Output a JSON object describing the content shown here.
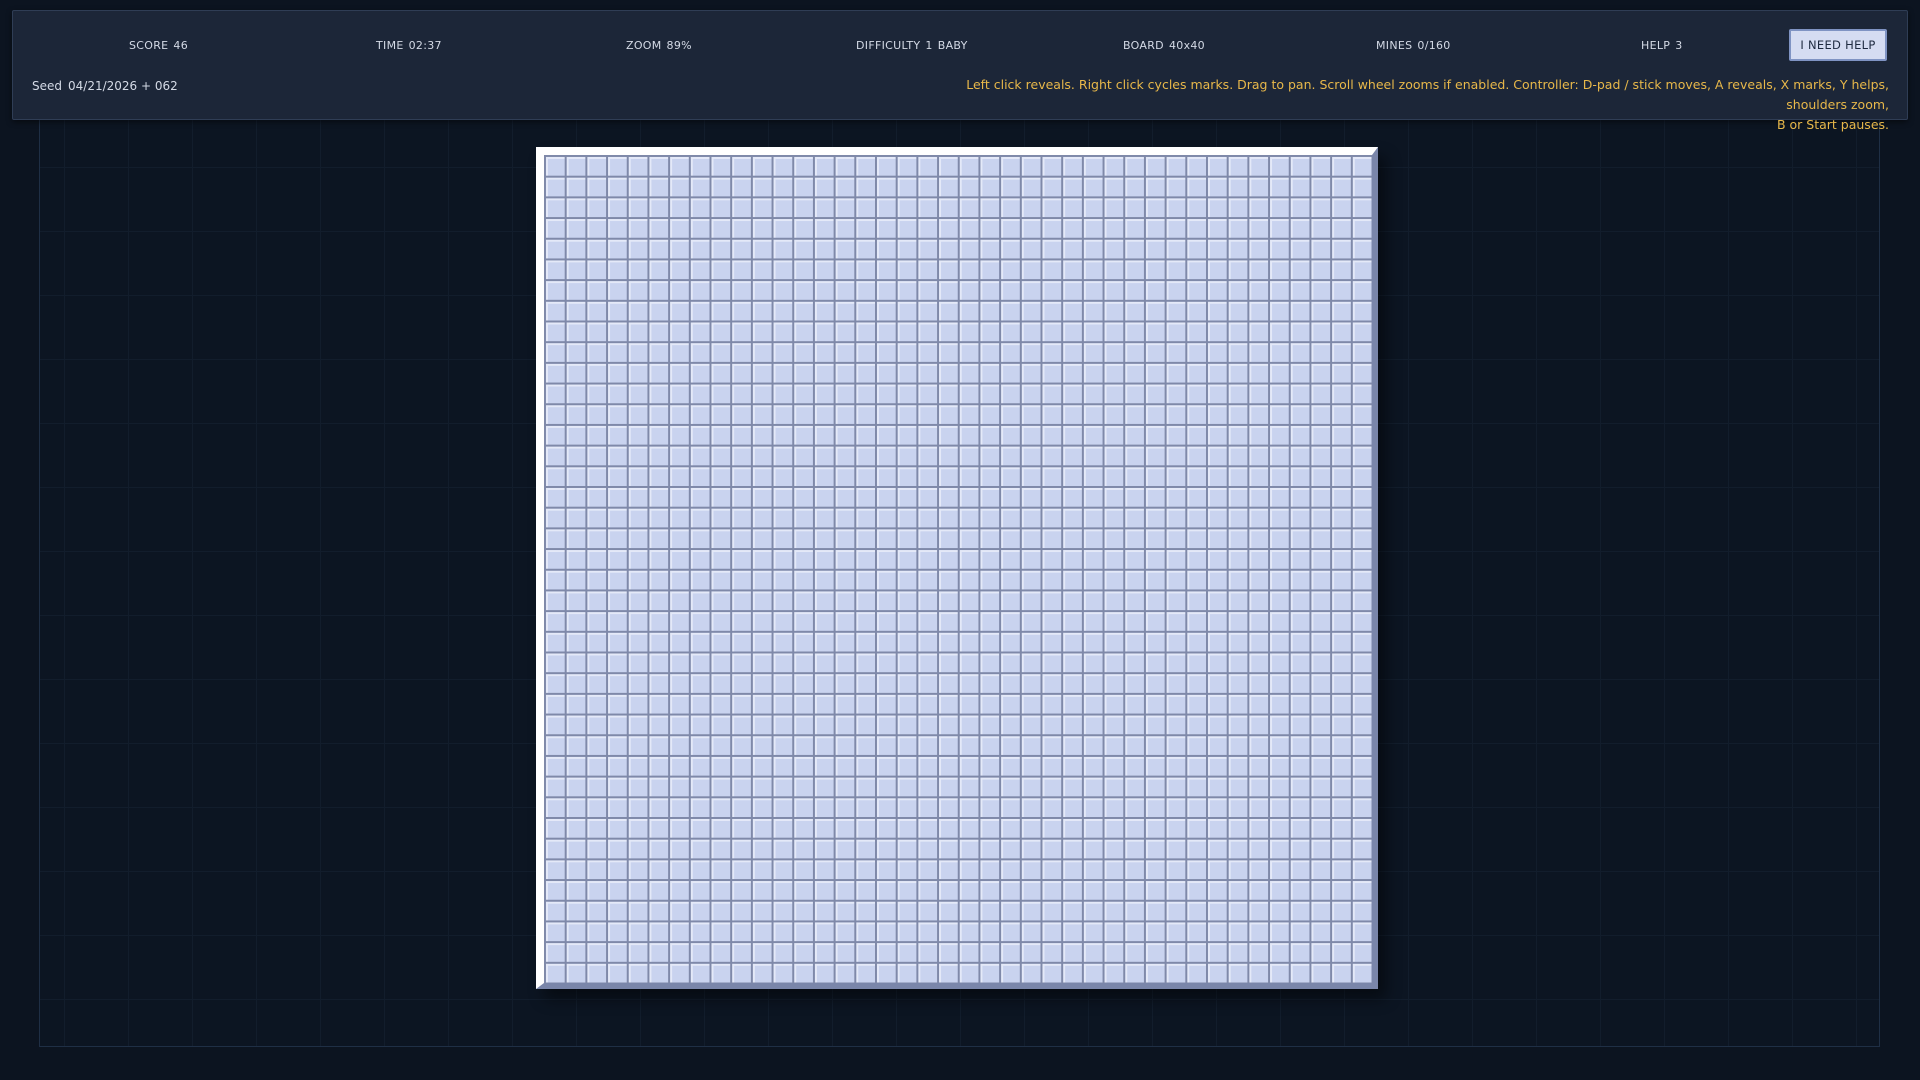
{
  "hud": {
    "score": {
      "label": "SCORE",
      "value": "46"
    },
    "time": {
      "label": "TIME",
      "value": "02:37"
    },
    "zoom": {
      "label": "ZOOM",
      "value": "89%"
    },
    "difficulty": {
      "label": "DIFFICULTY",
      "value": "1",
      "name": "BABY"
    },
    "board": {
      "label": "BOARD",
      "value": "40x40"
    },
    "mines": {
      "label": "MINES",
      "value": "0/160"
    },
    "help": {
      "label": "HELP",
      "value": "3"
    },
    "help_button_label": "I NEED HELP",
    "seed": {
      "label": "Seed",
      "value": "04/21/2026 + 062"
    },
    "instructions_line1": "Left click reveals. Right click cycles marks. Drag to pan. Scroll wheel zooms if enabled. Controller: D-pad / stick moves, A reveals, X marks, Y helps, shoulders zoom,",
    "instructions_line2": "B or Start pauses."
  },
  "board": {
    "columns": 40,
    "rows": 40,
    "state": "all cells unrevealed"
  },
  "colors": {
    "background": "#0c1420",
    "hud_panel": "#1c2638",
    "instructions_text": "#e8b84a",
    "cell_face": "#c9d3ef",
    "help_button": "#d5dcf2"
  }
}
